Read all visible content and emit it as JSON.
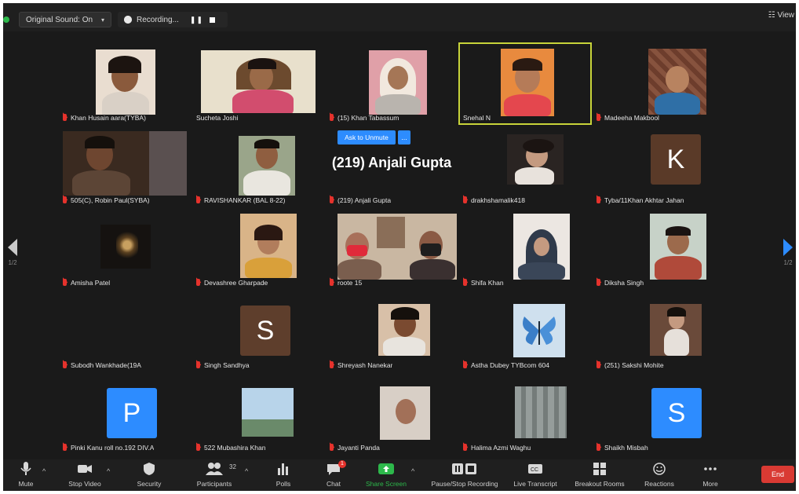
{
  "topbar": {
    "sound_label": "Original Sound: On",
    "recording_label": "Recording...",
    "view_label": "View"
  },
  "ask_unmute_label": "Ask to Unmute",
  "ask_more_label": "...",
  "featured_name": "(219) Anjali Gupta",
  "pager": {
    "prev": "1/2",
    "next": "1/2"
  },
  "participants": [
    {
      "name": "Khan Husain aara(TYBA)"
    },
    {
      "name": "Sucheta Joshi"
    },
    {
      "name": "(15) Khan Tabassum"
    },
    {
      "name": "Snehal N"
    },
    {
      "name": "Madeeha Makbool"
    },
    {
      "name": "505(C), Robin Paul(SYBA)"
    },
    {
      "name": "RAVISHANKAR (BAL 8-22)"
    },
    {
      "name": "(219) Anjali Gupta"
    },
    {
      "name": "drakhshamalik418"
    },
    {
      "name": "Tyba/11Khan Akhtar Jahan",
      "initial": "K"
    },
    {
      "name": "Amisha Patel"
    },
    {
      "name": "Devashree Gharpade"
    },
    {
      "name": "roote 15"
    },
    {
      "name": "Shifa Khan"
    },
    {
      "name": "Diksha Singh"
    },
    {
      "name": "Subodh Wankhade(19A"
    },
    {
      "name": "Singh Sandhya",
      "initial": "S"
    },
    {
      "name": "Shreyash Nanekar"
    },
    {
      "name": "Astha Dubey TYBcom 604"
    },
    {
      "name": "(251) Sakshi Mohite"
    },
    {
      "name": "Pinki Kanu roll no.192 DIV.A",
      "initial": "P"
    },
    {
      "name": "522 Mubashira Khan"
    },
    {
      "name": "Jayanti Panda"
    },
    {
      "name": "Halima Azmi Waghu"
    },
    {
      "name": "Shaikh Misbah",
      "initial": "S"
    }
  ],
  "toolbar": {
    "mute": "Mute",
    "stop_video": "Stop Video",
    "security": "Security",
    "participants": "Participants",
    "participants_count": "32",
    "polls": "Polls",
    "chat": "Chat",
    "chat_badge": "1",
    "share_screen": "Share Screen",
    "pause_recording": "Pause/Stop Recording",
    "live_transcript": "Live Transcript",
    "breakout_rooms": "Breakout Rooms",
    "reactions": "Reactions",
    "more": "More",
    "end": "End"
  },
  "colors": {
    "accent": "#2d8cff",
    "active_speaker": "#c8d43a",
    "end": "#d93a33",
    "share": "#2db84b"
  }
}
